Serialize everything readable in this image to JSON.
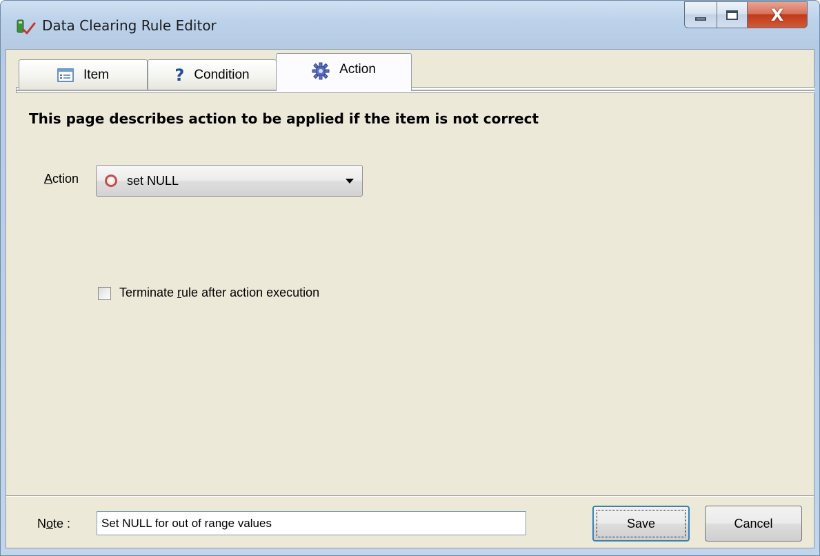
{
  "window": {
    "title": "Data Clearing Rule Editor",
    "close_glyph": "X"
  },
  "tabs": [
    {
      "label": "Item",
      "icon": "list-window-icon",
      "active": false
    },
    {
      "label": "Condition",
      "icon": "question-mark-icon",
      "active": false
    },
    {
      "label": "Action",
      "icon": "gear-icon",
      "active": true
    }
  ],
  "action_page": {
    "heading": "This page describes action to be applied if the item is not correct",
    "action_label_accel": "A",
    "action_label_rest": "ction",
    "action_value": "set NULL",
    "terminate_label_pre": "Terminate ",
    "terminate_label_accel": "r",
    "terminate_label_post": "ule after action execution",
    "terminate_checked": false
  },
  "footer": {
    "note_label_pre": "N",
    "note_label_accel": "o",
    "note_label_post": "te :",
    "note_value": "Set NULL for out of range values",
    "save_label": "Save",
    "cancel_label": "Cancel"
  },
  "colors": {
    "client_bg": "#ece9d8",
    "close_button": "#c2391b",
    "accent_border": "#3c7fb1"
  }
}
